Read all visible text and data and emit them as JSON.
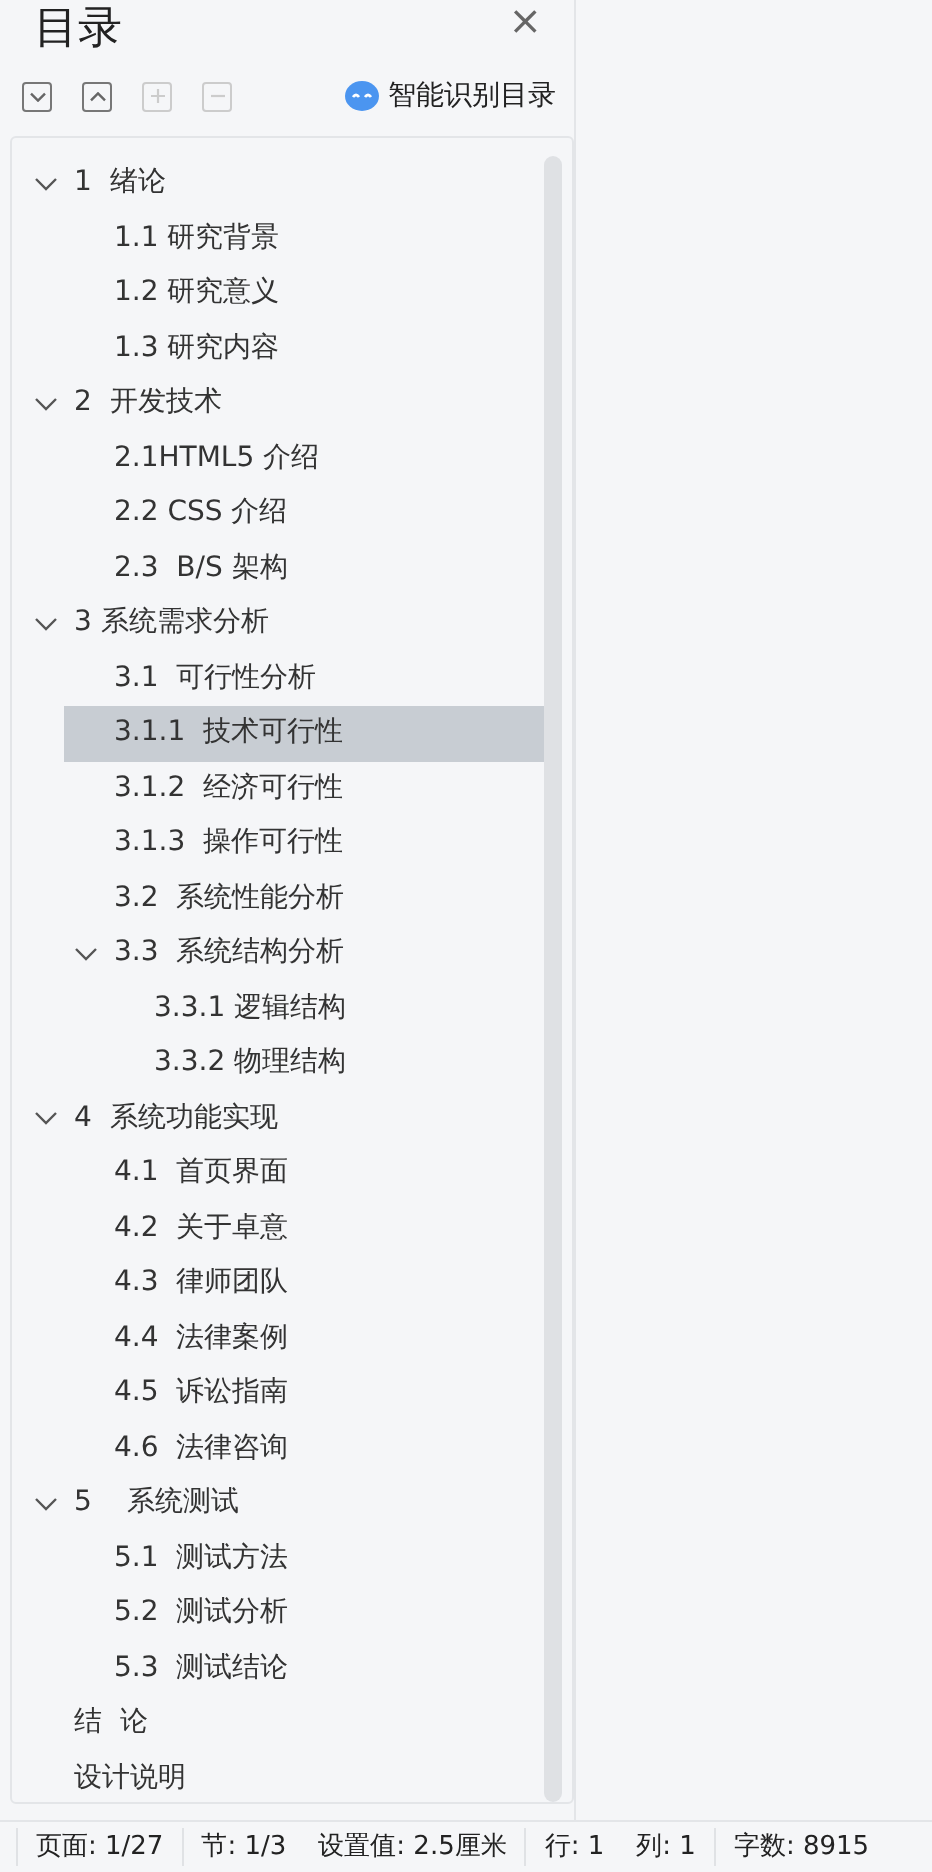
{
  "panel": {
    "title": "目录",
    "close": "×"
  },
  "toolbar": {
    "buttons": [
      {
        "kind": "expand",
        "disabled": false
      },
      {
        "kind": "collapse",
        "disabled": false
      },
      {
        "kind": "add",
        "disabled": true
      },
      {
        "kind": "remove",
        "disabled": true
      }
    ],
    "smart_label": "智能识别目录"
  },
  "toc": [
    {
      "label": "1  绪论",
      "expanded": true,
      "selected": false,
      "children": [
        {
          "label": "1.1 研究背景",
          "selected": false
        },
        {
          "label": "1.2 研究意义",
          "selected": false
        },
        {
          "label": "1.3 研究内容",
          "selected": false
        }
      ]
    },
    {
      "label": "2  开发技术",
      "expanded": true,
      "selected": false,
      "children": [
        {
          "label": "2.1HTML5 介绍",
          "selected": false
        },
        {
          "label": "2.2 CSS 介绍",
          "selected": false
        },
        {
          "label": "2.3  B/S 架构",
          "selected": false
        }
      ]
    },
    {
      "label": "3 系统需求分析",
      "expanded": true,
      "selected": false,
      "children": [
        {
          "label": "3.1  可行性分析",
          "selected": false
        },
        {
          "label": "3.1.1  技术可行性",
          "selected": true
        },
        {
          "label": "3.1.2  经济可行性",
          "selected": false
        },
        {
          "label": "3.1.3  操作可行性",
          "selected": false
        },
        {
          "label": "3.2  系统性能分析",
          "selected": false
        },
        {
          "label": "3.3  系统结构分析",
          "expanded": true,
          "selected": false,
          "children": [
            {
              "label": "3.3.1 逻辑结构",
              "selected": false
            },
            {
              "label": "3.3.2 物理结构",
              "selected": false
            }
          ]
        }
      ]
    },
    {
      "label": "4  系统功能实现",
      "expanded": true,
      "selected": false,
      "children": [
        {
          "label": "4.1  首页界面",
          "selected": false
        },
        {
          "label": "4.2  关于卓意",
          "selected": false
        },
        {
          "label": "4.3  律师团队",
          "selected": false
        },
        {
          "label": "4.4  法律案例",
          "selected": false
        },
        {
          "label": "4.5  诉讼指南",
          "selected": false
        },
        {
          "label": "4.6  法律咨询",
          "selected": false
        }
      ]
    },
    {
      "label": "5    系统测试",
      "expanded": true,
      "selected": false,
      "children": [
        {
          "label": "5.1  测试方法",
          "selected": false
        },
        {
          "label": "5.2  测试分析",
          "selected": false
        },
        {
          "label": "5.3  测试结论",
          "selected": false
        }
      ]
    },
    {
      "label": "结  论",
      "selected": false
    },
    {
      "label": "设计说明",
      "selected": false
    }
  ],
  "status_bar": [
    [
      "页面: 1/27"
    ],
    [
      "节: 1/3",
      "设置值: 2.5厘米"
    ],
    [
      "行: 1",
      "列: 1"
    ],
    [
      "字数: 8915"
    ]
  ]
}
